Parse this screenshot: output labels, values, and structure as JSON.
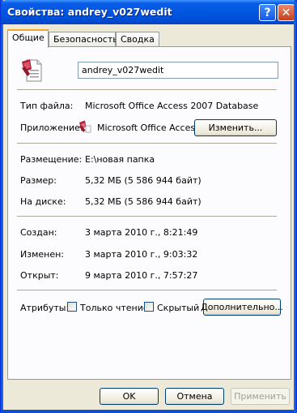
{
  "window": {
    "title": "Свойства: andrey_v027wedit",
    "help_glyph": "?",
    "close_glyph": "✕"
  },
  "tabs": [
    {
      "label": "Общие",
      "active": true
    },
    {
      "label": "Безопасность",
      "active": false
    },
    {
      "label": "Сводка",
      "active": false
    }
  ],
  "general": {
    "file_icon": "access-database-file-icon",
    "file_name": "andrey_v027wedit",
    "file_type_label": "Тип файла:",
    "file_type_value": "Microsoft Office Access 2007 Database",
    "app_label": "Приложение:",
    "app_icon": "access-app-icon",
    "app_value": "Microsoft Office Access",
    "change_button": "Изменить...",
    "location_label": "Размещение:",
    "location_value": "E:\\новая папка",
    "size_label": "Размер:",
    "size_value": "5,32 МБ (5 586 944 байт)",
    "disk_label": "На диске:",
    "disk_value": "5,32 МБ (5 586 944 байт)",
    "created_label": "Создан:",
    "created_value": "3 марта 2010 г., 8:21:49",
    "modified_label": "Изменен:",
    "modified_value": "3 марта 2010 г., 9:03:32",
    "opened_label": "Открыт:",
    "opened_value": "9 марта 2010 г., 7:57:27",
    "attributes_label": "Атрибуты:",
    "readonly_label": "Только чтение",
    "readonly_checked": false,
    "hidden_label": "Скрытый",
    "hidden_checked": false,
    "advanced_button": "Дополнительно..."
  },
  "footer": {
    "ok": "OK",
    "cancel": "Отмена",
    "apply": "Применить"
  },
  "colors": {
    "title_bar": "#0056e0",
    "window_bg": "#ece9d8",
    "panel_bg": "#fcfcfe",
    "tab_highlight": "#f5a623"
  }
}
